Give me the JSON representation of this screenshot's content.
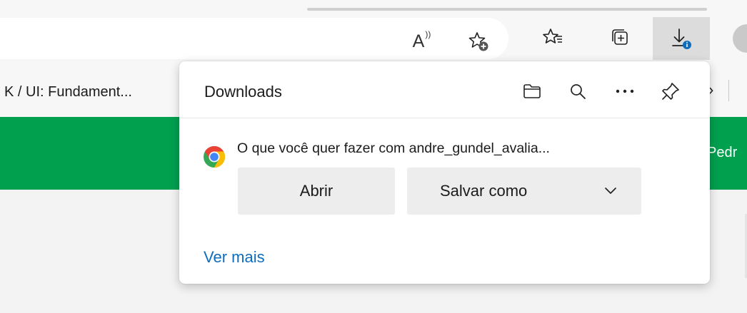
{
  "toolbar": {
    "icons": {
      "read_aloud": "read-aloud-icon",
      "add_favorite": "add-favorite-icon",
      "favorites": "favorites-icon",
      "collections": "collections-icon",
      "downloads": "downloads-icon",
      "profile": "avatar"
    },
    "read_aloud_glyph": "A"
  },
  "favorites_bar": {
    "item_label": "K / UI: Fundament...",
    "overflow_glyph": "›"
  },
  "page": {
    "banner_text": "Pedr",
    "banner_color": "#00a04f"
  },
  "downloads_panel": {
    "title": "Downloads",
    "icons": [
      "folder-icon",
      "search-icon",
      "more-icon",
      "pin-icon"
    ],
    "item": {
      "app_icon": "chrome-icon",
      "message": "O que você quer fazer com andre_gundel_avalia...",
      "open_label": "Abrir",
      "save_as_label": "Salvar como"
    },
    "more_link": "Ver mais",
    "link_color": "#0f6cbd"
  }
}
